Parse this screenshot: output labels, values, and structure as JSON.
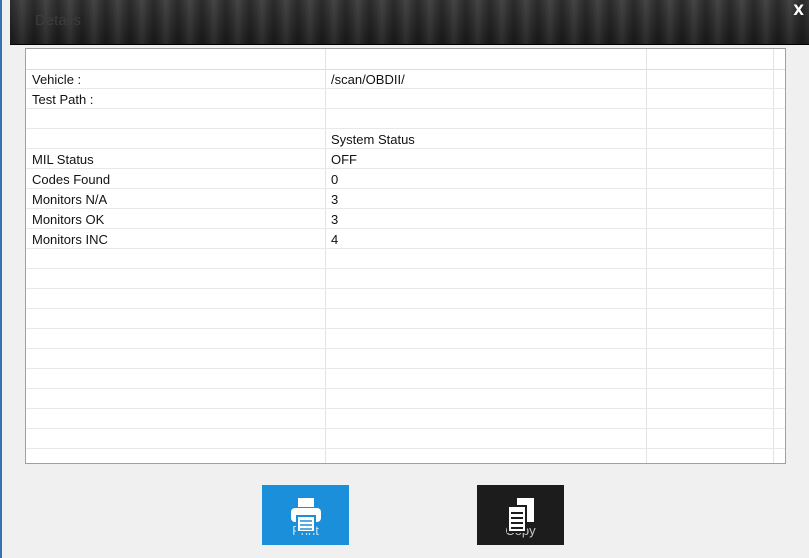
{
  "window": {
    "title": "Details",
    "close_label": "X"
  },
  "grid": {
    "rows": [
      {
        "label": "Vehicle :",
        "value": "/scan/OBDII/"
      },
      {
        "label": "Test Path :",
        "value": ""
      },
      {
        "label": "",
        "value": ""
      },
      {
        "label": "",
        "value": "System Status"
      },
      {
        "label": "MIL Status",
        "value": "OFF"
      },
      {
        "label": "Codes Found",
        "value": "0"
      },
      {
        "label": "Monitors N/A",
        "value": "3"
      },
      {
        "label": "Monitors OK",
        "value": "3"
      },
      {
        "label": "Monitors INC",
        "value": "4"
      }
    ]
  },
  "buttons": {
    "print_label": "Print",
    "copy_label": "Copy",
    "print_icon": "printer-icon",
    "copy_icon": "copy-icon"
  },
  "colors": {
    "print_button": "#1b8fd9",
    "copy_button": "#1c1c1c",
    "window_border": "#3a6fb0"
  }
}
